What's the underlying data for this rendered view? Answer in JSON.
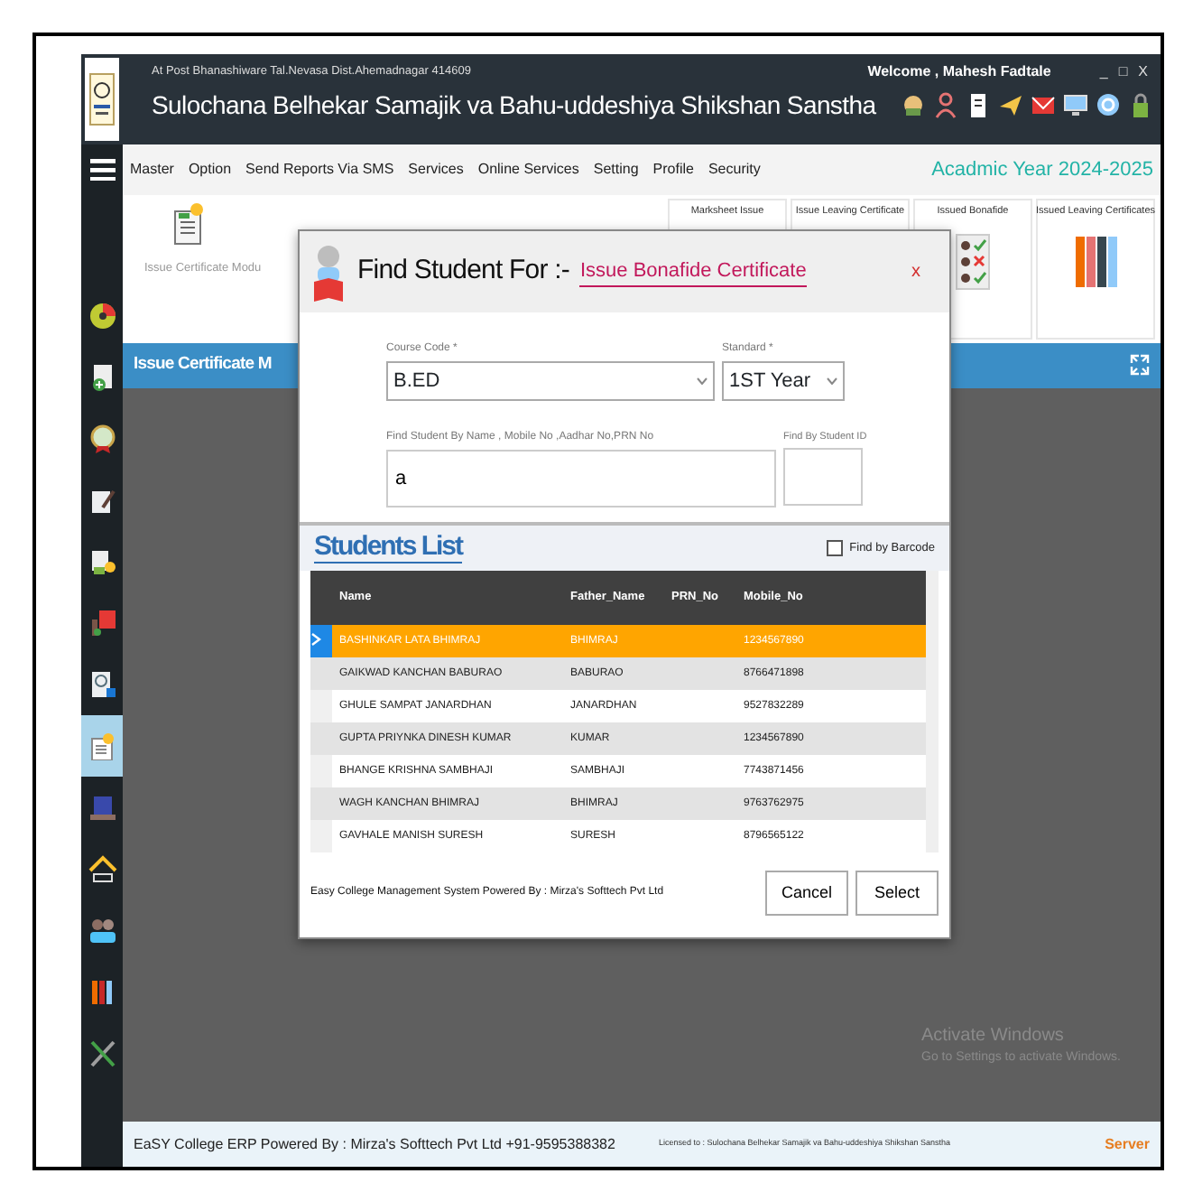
{
  "header": {
    "address": "At Post Bhanashiware Tal.Nevasa Dist.Ahemadnagar 414609",
    "welcome": "Welcome , Mahesh Fadtale",
    "window_controls": [
      "_",
      "□",
      "X"
    ],
    "title": "Sulochana Belhekar Samajik va Bahu-uddeshiya Shikshan Sanstha"
  },
  "menu": {
    "items": [
      "Master",
      "Option",
      "Send Reports Via SMS",
      "Services",
      "Online Services",
      "Setting",
      "Profile",
      "Security"
    ],
    "academic_year": "Acadmic Year 2024-2025"
  },
  "sidebar": {
    "items": [
      {
        "selected": false
      },
      {
        "selected": false
      },
      {
        "selected": false
      },
      {
        "selected": false
      },
      {
        "selected": false
      },
      {
        "selected": false
      },
      {
        "selected": false
      },
      {
        "selected": true
      },
      {
        "selected": false
      },
      {
        "selected": false
      },
      {
        "selected": false
      },
      {
        "selected": false
      },
      {
        "selected": false
      }
    ]
  },
  "module": {
    "title": "Issue Certificate Modu",
    "tiles": [
      {
        "label": "Marksheet Issue"
      },
      {
        "label": "Issue Leaving Certificate"
      },
      {
        "label": "Issued Bonafide"
      },
      {
        "label": "Issued Leaving Certificates"
      }
    ]
  },
  "band": {
    "title": "Issue Certificate M"
  },
  "dialog": {
    "title": "Find Student For :-",
    "purpose": "Issue Bonafide Certificate",
    "close": "x",
    "course_code": {
      "label": "Course Code *",
      "value": "B.ED"
    },
    "standard": {
      "label": "Standard *",
      "value": "1ST Year"
    },
    "search": {
      "label": "Find Student By Name , Mobile No ,Aadhar No,PRN No",
      "value": "a"
    },
    "student_id": {
      "label": "Find By Student ID"
    },
    "list_title": "Students List",
    "barcode": {
      "label": "Find by Barcode",
      "checked": false
    },
    "table": {
      "columns": [
        "Name",
        "Father_Name",
        "PRN_No",
        "Mobile_No"
      ],
      "rows": [
        {
          "cells": [
            "BASHINKAR LATA BHIMRAJ",
            "BHIMRAJ",
            "",
            "1234567890"
          ],
          "selected": true
        },
        {
          "cells": [
            "GAIKWAD KANCHAN BABURAO",
            "BABURAO",
            "",
            "8766471898"
          ],
          "selected": false
        },
        {
          "cells": [
            "GHULE SAMPAT JANARDHAN",
            "JANARDHAN",
            "",
            "9527832289"
          ],
          "selected": false
        },
        {
          "cells": [
            "GUPTA PRIYNKA DINESH KUMAR",
            "KUMAR",
            "",
            "1234567890"
          ],
          "selected": false
        },
        {
          "cells": [
            "BHANGE KRISHNA SAMBHAJI",
            "SAMBHAJI",
            "",
            "7743871456"
          ],
          "selected": false
        },
        {
          "cells": [
            "WAGH KANCHAN BHIMRAJ",
            "BHIMRAJ",
            "",
            "9763762975"
          ],
          "selected": false
        },
        {
          "cells": [
            "GAVHALE MANISH SURESH",
            "SURESH",
            "",
            "8796565122"
          ],
          "selected": false
        }
      ]
    },
    "powered": "Easy College Management System Powered By : Mirza's Softtech Pvt Ltd",
    "buttons": [
      "Cancel",
      "Select"
    ]
  },
  "os_notice": {
    "title": "Activate Windows",
    "text": "Go to Settings to activate Windows."
  },
  "footer": {
    "powered": "EaSY College ERP Powered By : Mirza's Softtech Pvt Ltd +91-9595388382",
    "license": "Licensed to :  Sulochana Belhekar Samajik va Bahu-uddeshiya Shikshan Sanstha",
    "server": "Server"
  }
}
